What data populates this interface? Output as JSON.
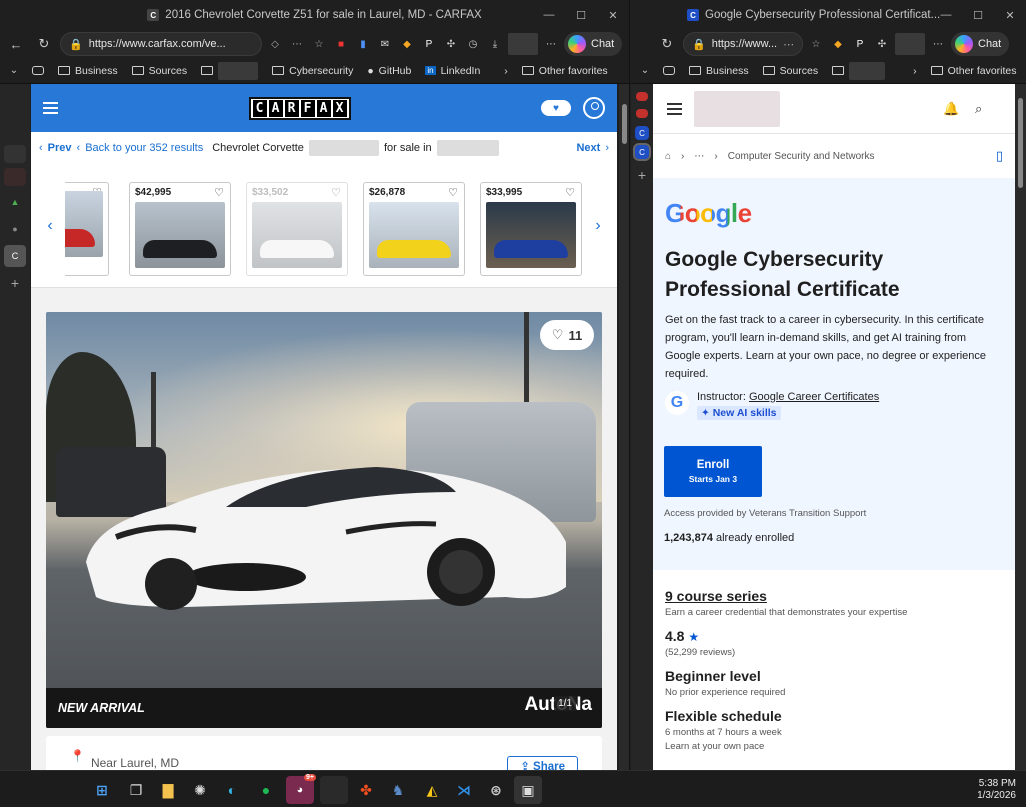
{
  "left_window": {
    "title": "2016 Chevrolet Corvette Z51 for sale in Laurel, MD - CARFAX",
    "url": "https://www.carfax.com/ve...",
    "chat_label": "Chat",
    "bookmarks": [
      "Business",
      "Sources",
      "Cybersecurity",
      "GitHub",
      "LinkedIn",
      "Other favorites"
    ]
  },
  "right_window": {
    "title": "Google Cybersecurity Professional Certificat...",
    "url": "https://www...",
    "chat_label": "Chat",
    "bookmarks": [
      "Business",
      "Sources",
      "Other favorites"
    ]
  },
  "carfax": {
    "logo_letters": [
      "C",
      "A",
      "R",
      "F",
      "A",
      "X"
    ],
    "nav": {
      "prev": "Prev",
      "back": "Back to your 352 results",
      "title_prefix": "Chevrolet Corvette",
      "title_mid": "for sale in",
      "next": "Next"
    },
    "thumbnails": [
      {
        "price": ""
      },
      {
        "price": "$42,995"
      },
      {
        "price": "$33,502"
      },
      {
        "price": "$26,878"
      },
      {
        "price": "$33,995"
      }
    ],
    "hero": {
      "favorites": "11",
      "badge": "NEW ARRIVAL",
      "dealer": "AutoNa",
      "photo_count": "1/1"
    },
    "location": "Near Laurel, MD",
    "share": "Share"
  },
  "coursera": {
    "breadcrumb": "Computer Security and Networks",
    "logo": "Google",
    "title": "Google Cybersecurity Professional Certificate",
    "description": "Get on the fast track to a career in cybersecurity. In this certificate program, you'll learn in-demand skills, and get AI training from Google experts. Learn at your own pace, no degree or experience required.",
    "instructor_label": "Instructor:",
    "instructor": "Google Career Certificates",
    "ai_tag": "New AI skills",
    "enroll": "Enroll",
    "enroll_sub": "Starts Jan 3",
    "access": "Access provided by Veterans Transition Support",
    "enrolled_count": "1,243,874",
    "enrolled_suffix": "already enrolled",
    "series_title": "9 course series",
    "series_sub": "Earn a career credential that demonstrates your expertise",
    "rating": "4.8",
    "reviews": "(52,299 reviews)",
    "level": "Beginner level",
    "level_sub": "No prior experience required",
    "schedule": "Flexible schedule",
    "schedule_sub": "6 months at 7 hours a week",
    "schedule_sub2": "Learn at your own pace"
  },
  "taskbar": {
    "time": "5:38 PM",
    "date": "1/3/2026",
    "badge": "9+"
  },
  "colors": {
    "carfax_blue": "#2878d8",
    "coursera_blue": "#0056d2",
    "link_blue": "#1a6fd0"
  }
}
